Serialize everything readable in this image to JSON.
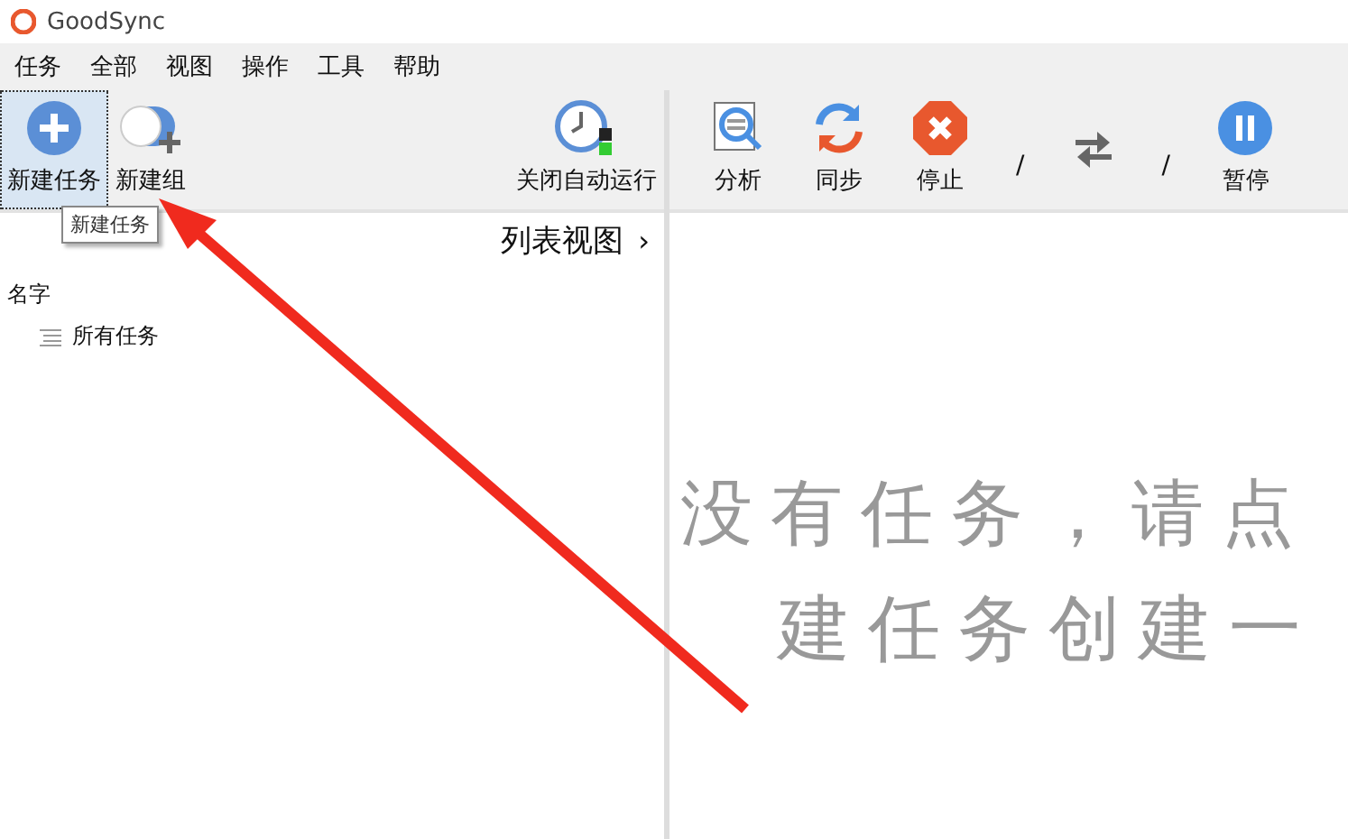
{
  "window": {
    "title": "GoodSync"
  },
  "menu": [
    "任务",
    "全部",
    "视图",
    "操作",
    "工具",
    "帮助"
  ],
  "left_toolbar": [
    {
      "kind": "new-job",
      "label": "新建任务",
      "selected": true
    },
    {
      "kind": "new-group",
      "label": "新建组",
      "selected": false
    },
    {
      "kind": "auto-off",
      "label": "关闭自动运行",
      "selected": false
    }
  ],
  "tooltip": "新建任务",
  "right_toolbar": [
    {
      "kind": "analyze",
      "label": "分析"
    },
    {
      "kind": "sync",
      "label": "同步"
    },
    {
      "kind": "stop",
      "label": "停止"
    },
    {
      "kind": "slash",
      "label": "/"
    },
    {
      "kind": "swap"
    },
    {
      "kind": "slash",
      "label": "/"
    },
    {
      "kind": "pause",
      "label": "暂停"
    }
  ],
  "view_switch": {
    "label": "列表视图",
    "arrow": "›"
  },
  "tree": {
    "column": "名字",
    "items": [
      {
        "label": "所有任务"
      }
    ]
  },
  "empty_message": [
    "没有任务，请点",
    "建任务创建一"
  ]
}
